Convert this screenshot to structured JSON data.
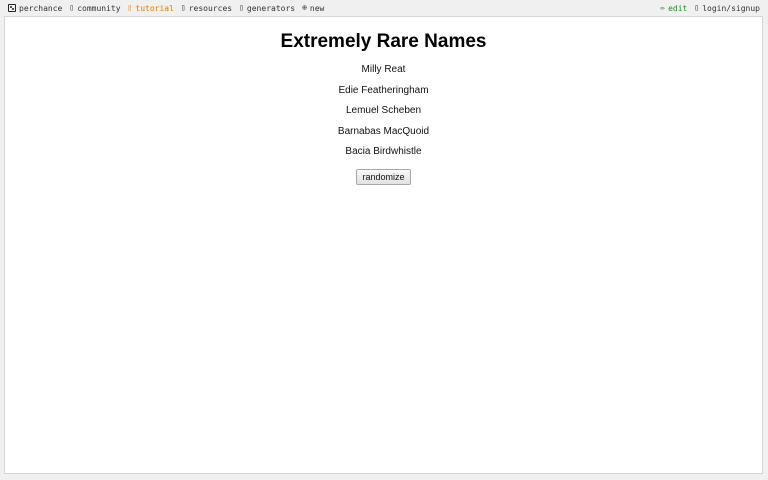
{
  "nav": {
    "brand": "perchance",
    "community": "community",
    "tutorial": "tutorial",
    "resources": "resources",
    "generators": "generators",
    "new": "new",
    "edit": "edit",
    "login": "login/signup"
  },
  "main": {
    "title": "Extremely Rare Names",
    "names": [
      "Milly Reat",
      "Edie Featheringham",
      "Lemuel Scheben",
      "Barnabas MacQuoid",
      "Bacia Birdwhistle"
    ],
    "randomize_label": "randomize"
  },
  "colors": {
    "tutorial": "#e07b00",
    "edit": "#2a8a2a"
  }
}
